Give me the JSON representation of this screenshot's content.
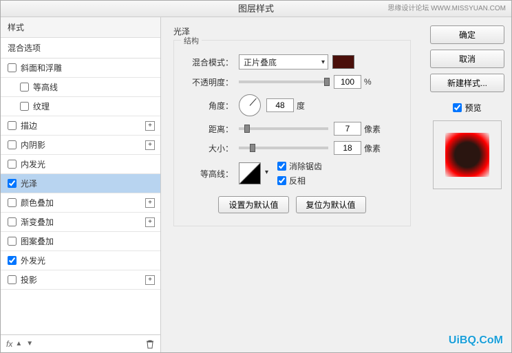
{
  "dialog": {
    "title": "图层样式",
    "watermark_top": "思缘设计论坛  WWW.MISSYUAN.COM"
  },
  "left": {
    "styles_header": "样式",
    "blend_header": "混合选项",
    "items": [
      {
        "label": "斜面和浮雕",
        "checked": false,
        "has_add": false,
        "indent": false
      },
      {
        "label": "等高线",
        "checked": false,
        "has_add": false,
        "indent": true
      },
      {
        "label": "纹理",
        "checked": false,
        "has_add": false,
        "indent": true
      },
      {
        "label": "描边",
        "checked": false,
        "has_add": true,
        "indent": false
      },
      {
        "label": "内阴影",
        "checked": false,
        "has_add": true,
        "indent": false
      },
      {
        "label": "内发光",
        "checked": false,
        "has_add": false,
        "indent": false
      },
      {
        "label": "光泽",
        "checked": true,
        "has_add": false,
        "indent": false,
        "selected": true
      },
      {
        "label": "颜色叠加",
        "checked": false,
        "has_add": true,
        "indent": false
      },
      {
        "label": "渐变叠加",
        "checked": false,
        "has_add": true,
        "indent": false
      },
      {
        "label": "图案叠加",
        "checked": false,
        "has_add": false,
        "indent": false
      },
      {
        "label": "外发光",
        "checked": true,
        "has_add": false,
        "indent": false
      },
      {
        "label": "投影",
        "checked": false,
        "has_add": true,
        "indent": false
      }
    ],
    "footer_fx": "fx"
  },
  "center": {
    "title": "光泽",
    "fieldset_label": "结构",
    "blend_mode_label": "混合模式：",
    "blend_mode_value": "正片叠底",
    "color": "#4a0f0a",
    "opacity_label": "不透明度：",
    "opacity_value": "100",
    "opacity_unit": "%",
    "angle_label": "角度：",
    "angle_value": "48",
    "angle_unit": "度",
    "distance_label": "距离：",
    "distance_value": "7",
    "distance_unit": "像素",
    "size_label": "大小：",
    "size_value": "18",
    "size_unit": "像素",
    "contour_label": "等高线：",
    "antialias_label": "消除锯齿",
    "antialias_checked": true,
    "invert_label": "反相",
    "invert_checked": true,
    "reset_default": "设置为默认值",
    "restore_default": "复位为默认值"
  },
  "right": {
    "ok": "确定",
    "cancel": "取消",
    "new_style": "新建样式...",
    "preview_label": "预览"
  },
  "bottom_watermark": "UiBQ.CoM"
}
